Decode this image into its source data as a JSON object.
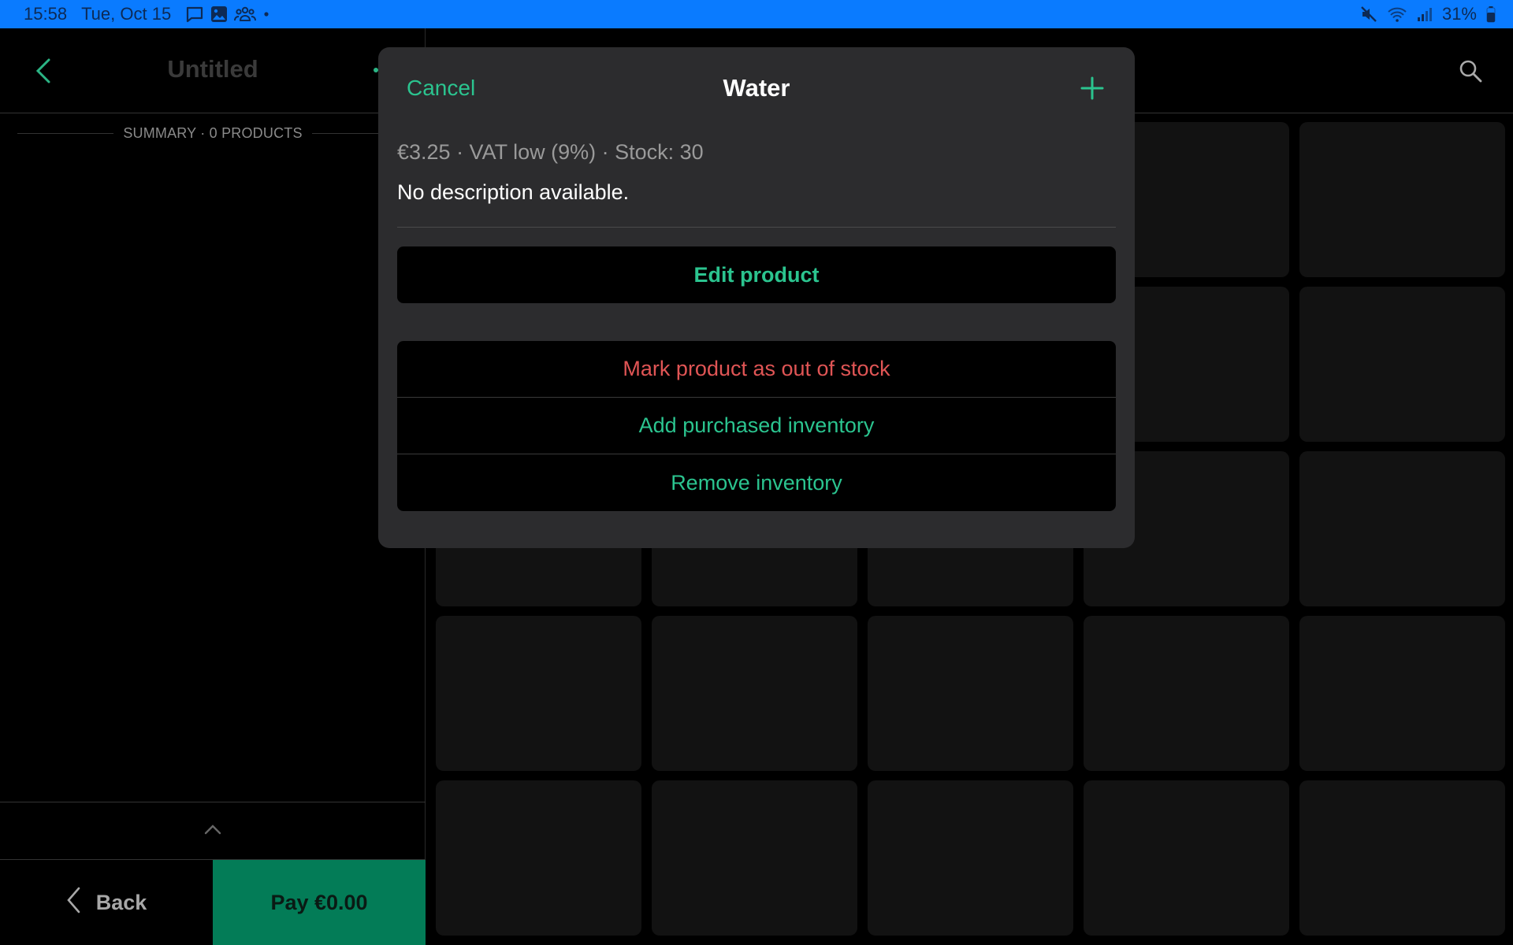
{
  "status_bar": {
    "time": "15:58",
    "date": "Tue, Oct 15",
    "notification_icons": [
      "message-icon",
      "gallery-icon",
      "people-icon",
      "more-dot-icon"
    ],
    "system_icons": [
      "mute-icon",
      "wifi-icon",
      "signal-icon",
      "battery-icon"
    ],
    "battery": "31%"
  },
  "left_panel": {
    "title": "Untitled",
    "summary": "SUMMARY · 0 PRODUCTS",
    "back_label": "Back",
    "pay_label": "Pay €0.00"
  },
  "right_panel": {
    "tile_count": 25
  },
  "modal": {
    "cancel_label": "Cancel",
    "title": "Water",
    "meta": "€3.25 · VAT low (9%) · Stock: 30",
    "description": "No description available.",
    "edit_label": "Edit product",
    "actions": [
      {
        "label": "Mark product as out of stock",
        "style": "danger"
      },
      {
        "label": "Add purchased inventory",
        "style": "accent"
      },
      {
        "label": "Remove inventory",
        "style": "accent"
      }
    ]
  },
  "colors": {
    "status_bar": "#0A7BFF",
    "accent": "#2bc48f",
    "danger": "#e05555",
    "pay_button": "#037c57",
    "modal_bg": "#2c2c2e",
    "tile_bg": "#121212"
  }
}
